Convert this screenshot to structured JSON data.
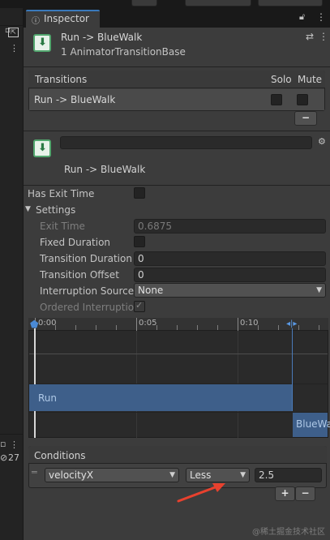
{
  "tab": {
    "label": "Inspector"
  },
  "header": {
    "title": "Run -> BlueWalk",
    "subtitle": "1 AnimatorTransitionBase"
  },
  "transitions": {
    "header_label": "Transitions",
    "solo_label": "Solo",
    "mute_label": "Mute",
    "rows": [
      {
        "label": "Run -> BlueWalk"
      }
    ],
    "remove_label": "−"
  },
  "transition": {
    "name_value": "",
    "title": "Run -> BlueWalk"
  },
  "settings": {
    "has_exit_time_label": "Has Exit Time",
    "settings_label": "Settings",
    "exit_time_label": "Exit Time",
    "exit_time_value": "0.6875",
    "fixed_duration_label": "Fixed Duration",
    "transition_duration_label": "Transition Duration (",
    "transition_duration_value": "0",
    "transition_offset_label": "Transition Offset",
    "transition_offset_value": "0",
    "interruption_source_label": "Interruption Source",
    "interruption_source_value": "None",
    "ordered_interruption_label": "Ordered Interruption"
  },
  "timeline": {
    "ticks": [
      "0:00",
      "0:05",
      "0:10"
    ],
    "clip_from": "Run",
    "clip_to": "BlueWa"
  },
  "conditions": {
    "header_label": "Conditions",
    "parameter": "velocityX",
    "operator": "Less",
    "value": "2.5",
    "add_label": "+",
    "remove_label": "−"
  },
  "left_strip": {
    "count_label": "27"
  },
  "watermark": "@稀土掘金技术社区",
  "colors": {
    "accent": "#3a79bb",
    "clip_blue": "#3e5f8a",
    "annotation_red": "#e8412e"
  }
}
